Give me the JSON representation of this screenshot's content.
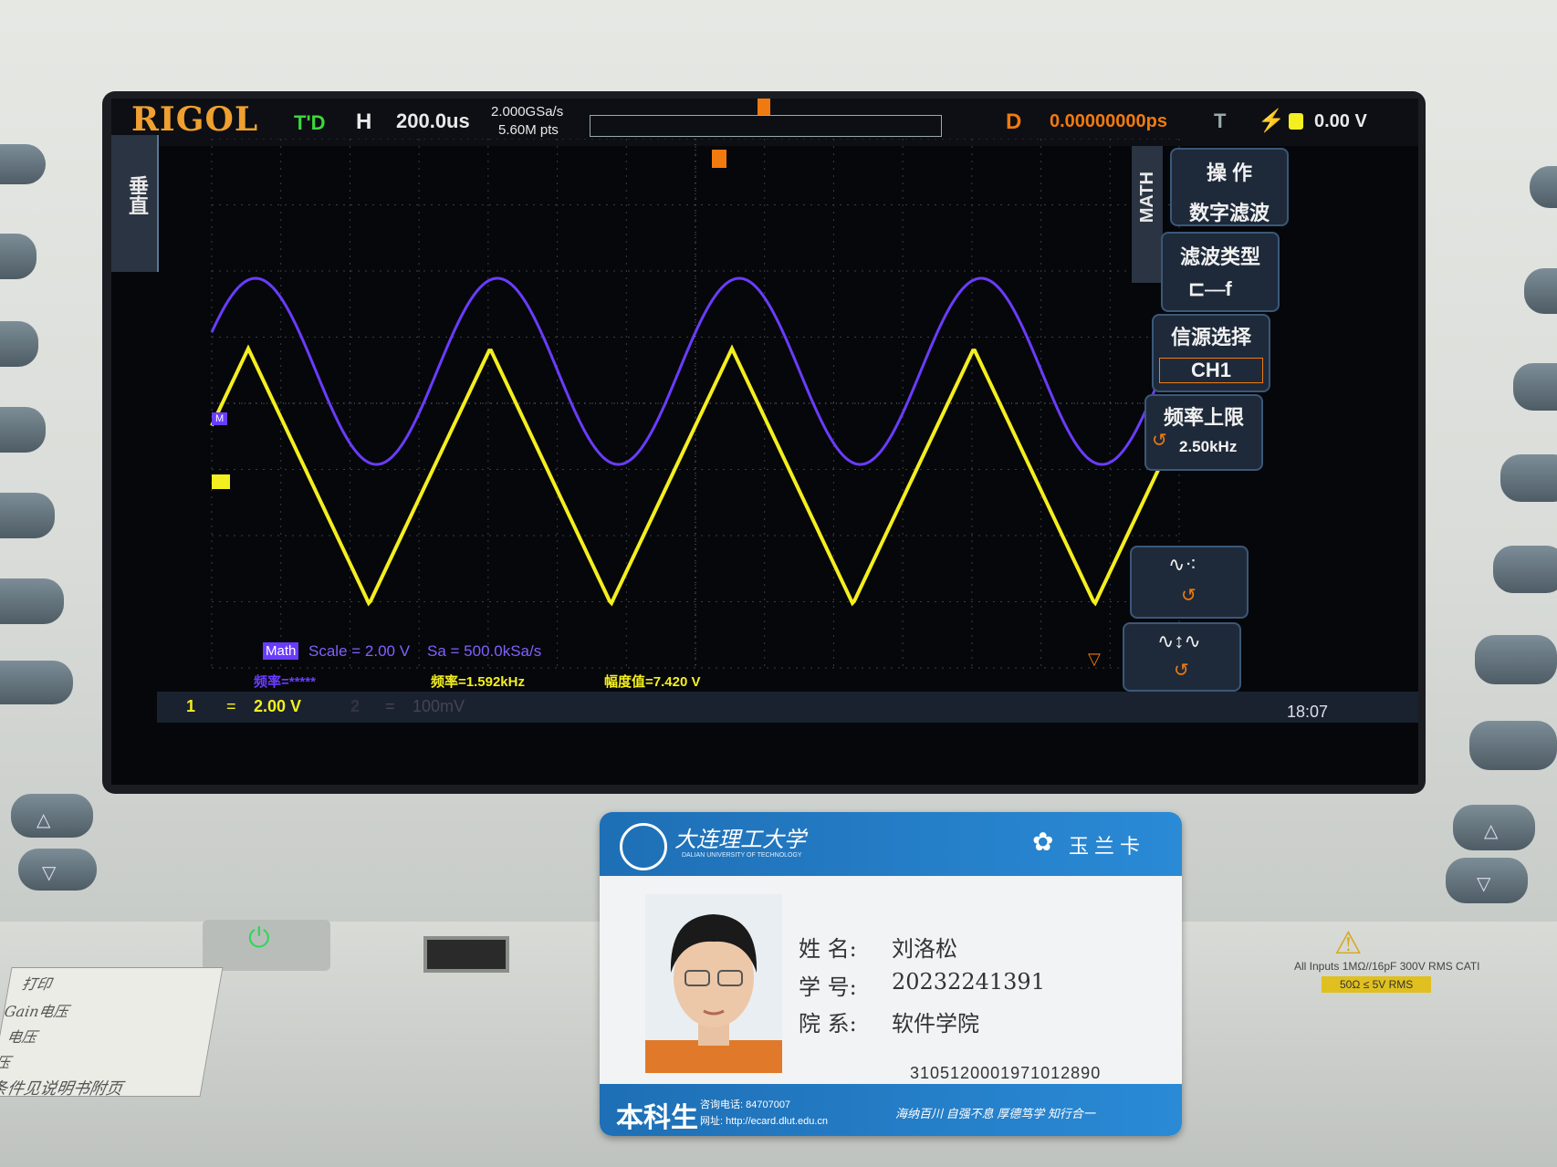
{
  "scope": {
    "brand": "RIGOL",
    "trigger_status": "T'D",
    "horizontal_label": "H",
    "timebase": "200.0us",
    "sample_rate": "2.000GSa/s",
    "memory_depth": "5.60M pts",
    "delay_label": "D",
    "delay_value": "0.00000000ps",
    "trigger_label": "T",
    "trigger_level": "0.00 V",
    "side_tab_vertical": "垂直",
    "math_tab": "MATH",
    "menu": {
      "operation_title": "操 作",
      "operation_value": "数字滤波",
      "filter_type_title": "滤波类型",
      "source_title": "信源选择",
      "source_value": "CH1",
      "freq_limit_title": "频率上限",
      "freq_limit_value": "2.50kHz"
    },
    "math_badge": "Math",
    "math_scale": "Scale = 2.00 V",
    "math_sa": "Sa = 500.0kSa/s",
    "meas_freq1": "频率=*****",
    "meas_freq2": "频率=1.592kHz",
    "meas_amp": "幅度值=7.420 V",
    "ch1_num": "1",
    "ch1_scale": "2.00 V",
    "ch2_num": "2",
    "ch2_scale": "100mV",
    "clock": "18:07",
    "marker_m": "M",
    "colors": {
      "ch1": "#f4ef1e",
      "math": "#6a3cff",
      "accent": "#f0a030"
    }
  },
  "panel": {
    "warning_line1": "All Inputs 1MΩ//16pF 300V RMS CATI",
    "warning_line2": "50Ω ≤ 5V RMS"
  },
  "card": {
    "university_cn": "大连理工大学",
    "university_en": "DALIAN UNIVERSITY OF TECHNOLOGY",
    "card_name": "玉兰卡",
    "name_label": "姓 名:",
    "name_value": "刘洛松",
    "id_label": "学 号:",
    "id_value": "20232241391",
    "dept_label": "院 系:",
    "dept_value": "软件学院",
    "card_number": "3105120001971012890",
    "level": "本科生",
    "phone": "咨询电话: 84707007",
    "website": "网址: http://ecard.dlut.edu.cn",
    "motto": "海纳百川 自强不息 厚德笃学 知行合一"
  },
  "sticker": {
    "line1": "打印",
    "line2": "Gain电压",
    "line3": "电压",
    "line4": "压",
    "line5": "条件见说明书附页"
  }
}
